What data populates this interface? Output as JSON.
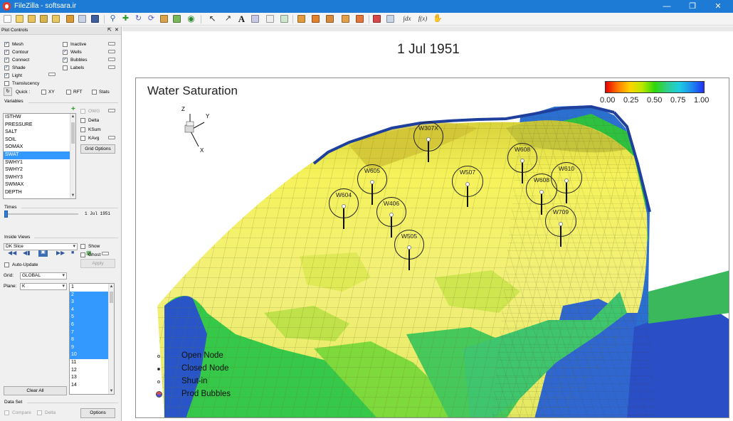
{
  "window": {
    "title": "FileZilla - softsara.ir",
    "minimize": "—",
    "restore": "❐",
    "close": "✕"
  },
  "toolbar": {
    "text_tool": "A",
    "formula1": "∫dx",
    "formula2": "f(x)"
  },
  "plot_controls": {
    "title": "Plot Controls",
    "pin": "⇱",
    "close": "✕",
    "options_left": [
      {
        "label": "Mesh",
        "checked": true
      },
      {
        "label": "Contour",
        "checked": true
      },
      {
        "label": "Connect",
        "checked": true
      },
      {
        "label": "Shade",
        "checked": true
      },
      {
        "label": "Light",
        "checked": true
      },
      {
        "label": "Translucency",
        "checked": false
      }
    ],
    "options_right": [
      {
        "label": "Inactive",
        "checked": false
      },
      {
        "label": "Wells",
        "checked": true
      },
      {
        "label": "Bubbles",
        "checked": true
      },
      {
        "label": "Labels",
        "checked": false
      }
    ],
    "quick_label": "Quick :",
    "quick_options": [
      "XY",
      "RFT",
      "Stats"
    ],
    "variables_label": "Variables",
    "variables": [
      "ISTHW",
      "PRESSURE",
      "SALT",
      "SOIL",
      "SOMAX",
      "SWAT",
      "SWHY1",
      "SWHY2",
      "SWHY3",
      "SWMAX",
      "DEPTH"
    ],
    "selected_variable": "SWAT",
    "variable_options": [
      {
        "label": "OWG",
        "enabled": false
      },
      {
        "label": "Delta",
        "enabled": true
      },
      {
        "label": "KSum",
        "enabled": true
      },
      {
        "label": "KAvg",
        "enabled": true
      }
    ],
    "grid_options_button": "Grid Options",
    "times_label": "Times",
    "time_value": "1 Jul 1951",
    "inside_views_label": "Inside Views",
    "inside_view": "DK Slice",
    "show_label": "Show",
    "ghost_label": "Ghost",
    "apply_button": "Apply",
    "auto_update_label": "Auto-Update",
    "grid_label": "Grid:",
    "grid_value": "GLOBAL",
    "plane_label": "Plane:",
    "plane_value": "K",
    "layers": [
      "1",
      "2",
      "3",
      "4",
      "5",
      "6",
      "7",
      "8",
      "9",
      "10",
      "11",
      "12",
      "13",
      "14"
    ],
    "selected_layers": [
      "2",
      "3",
      "4",
      "5",
      "6",
      "7",
      "8",
      "9",
      "10"
    ],
    "clear_all_button": "Clear All",
    "data_set_label": "Data Set",
    "compare_label": "Compare",
    "delta_label": "Delta",
    "options_button": "Options"
  },
  "view": {
    "date": "1 Jul 1951",
    "plot_title": "Water Saturation",
    "colorbar_ticks": [
      "0.00",
      "0.25",
      "0.50",
      "0.75",
      "1.00"
    ],
    "colorbar_colors": [
      "#e80000",
      "#ff7a00",
      "#ffd400",
      "#b9e800",
      "#2ed60a",
      "#2ecf8a",
      "#1ecde0",
      "#1e8cf0",
      "#1f31f5"
    ],
    "axis_labels": {
      "z": "Z",
      "y": "Y",
      "x": "X"
    },
    "wells": [
      "W307X",
      "W505",
      "W507",
      "W604",
      "W406",
      "W605",
      "W608",
      "W610",
      "W608",
      "W709"
    ],
    "legend": [
      "Open Node",
      "Closed Node",
      "Shut-in",
      "Prod Bubbles"
    ]
  }
}
